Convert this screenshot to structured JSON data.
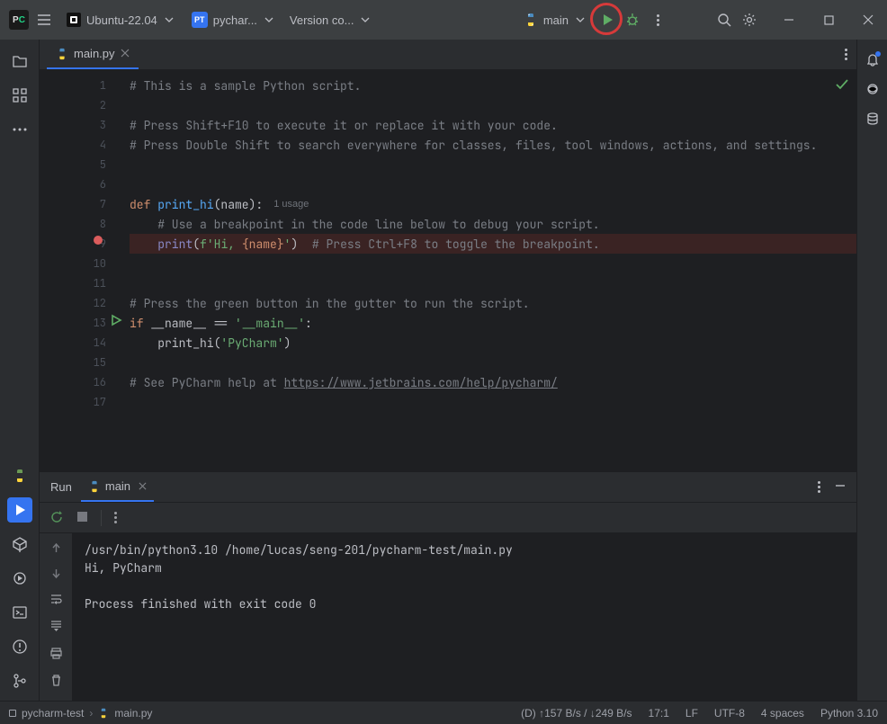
{
  "titlebar": {
    "wsl_label": "Ubuntu-22.04",
    "project_label": "pychar...",
    "project_badge": "PT",
    "vcs_label": "Version co...",
    "run_config": "main"
  },
  "tabs": {
    "file": "main.py"
  },
  "code": {
    "l1": "# This is a sample Python script.",
    "l3": "# Press Shift+F10 to execute it or replace it with your code.",
    "l4": "# Press Double Shift to search everywhere for classes, files, tool windows, actions, and settings.",
    "l7_kw": "def ",
    "l7_fn": "print_hi",
    "l7_rest": "(name):",
    "l7_usage": "1 usage",
    "l8": "    # Use a breakpoint in the code line below to debug your script.",
    "l9_a": "    ",
    "l9_print": "print",
    "l9_b": "(",
    "l9_f": "f'",
    "l9_hi": "Hi, ",
    "l9_tpl": "{name}",
    "l9_c": "'",
    "l9_d": ")  ",
    "l9_com": "# Press Ctrl+F8 to toggle the breakpoint.",
    "l12": "# Press the green button in the gutter to run the script.",
    "l13_if": "if ",
    "l13_name": "__name__ == ",
    "l13_str": "'__main__'",
    "l13_colon": ":",
    "l14_a": "    print_hi(",
    "l14_s": "'PyCharm'",
    "l14_b": ")",
    "l16a": "# See PyCharm help at ",
    "l16b": "https://www.jetbrains.com/help/pycharm/"
  },
  "line_numbers": [
    "1",
    "2",
    "3",
    "4",
    "5",
    "6",
    "7",
    "8",
    "9",
    "10",
    "11",
    "12",
    "13",
    "14",
    "15",
    "16",
    "17"
  ],
  "run": {
    "title": "Run",
    "tab": "main",
    "out1": "/usr/bin/python3.10 /home/lucas/seng-201/pycharm-test/main.py",
    "out2": "Hi, PyCharm",
    "out4": "Process finished with exit code 0"
  },
  "status": {
    "crumb1": "pycharm-test",
    "crumb2": "main.py",
    "net": "(D)  ↑157 B/s / ↓249 B/s",
    "pos": "17:1",
    "le": "LF",
    "enc": "UTF-8",
    "indent": "4 spaces",
    "interp": "Python 3.10"
  }
}
